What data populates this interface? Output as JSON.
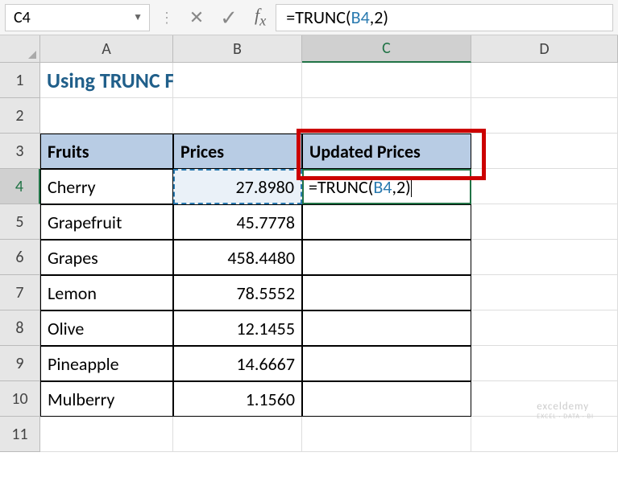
{
  "formula_bar": {
    "cell_ref": "C4",
    "formula_prefix": "=TRUNC(",
    "formula_ref": "B4",
    "formula_suffix": ",2)"
  },
  "columns": [
    "A",
    "B",
    "C",
    "D"
  ],
  "rows": [
    "1",
    "2",
    "3",
    "4",
    "5",
    "6",
    "7",
    "8",
    "9",
    "10",
    "11"
  ],
  "title": "Using TRUNC Function",
  "headers": {
    "fruits": "Fruits",
    "prices": "Prices",
    "updated": "Updated Prices"
  },
  "table": [
    {
      "fruit": "Cherry",
      "price": "27.8980"
    },
    {
      "fruit": "Grapefruit",
      "price": "45.7778"
    },
    {
      "fruit": "Grapes",
      "price": "458.4480"
    },
    {
      "fruit": "Lemon",
      "price": "78.5552"
    },
    {
      "fruit": "Olive",
      "price": "12.1455"
    },
    {
      "fruit": "Pineapple",
      "price": "14.6667"
    },
    {
      "fruit": "Mulberry",
      "price": "1.1560"
    }
  ],
  "editing": {
    "prefix": "=TRUNC(",
    "ref": "B4",
    "suffix": ",2)"
  },
  "watermark": {
    "main": "exceldemy",
    "sub": "EXCEL · DATA · BI"
  },
  "chart_data": {
    "type": "table",
    "title": "Using TRUNC Function",
    "columns": [
      "Fruits",
      "Prices",
      "Updated Prices"
    ],
    "rows": [
      [
        "Cherry",
        27.898,
        "=TRUNC(B4,2)"
      ],
      [
        "Grapefruit",
        45.7778,
        null
      ],
      [
        "Grapes",
        458.448,
        null
      ],
      [
        "Lemon",
        78.5552,
        null
      ],
      [
        "Olive",
        12.1455,
        null
      ],
      [
        "Pineapple",
        14.6667,
        null
      ],
      [
        "Mulberry",
        1.156,
        null
      ]
    ]
  }
}
